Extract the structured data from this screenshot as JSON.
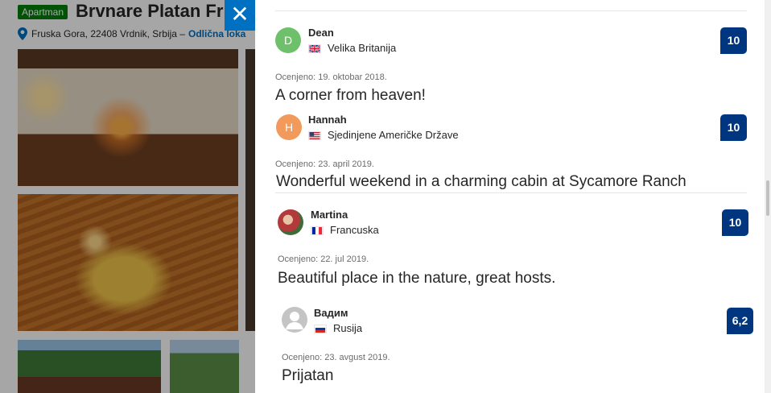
{
  "listing": {
    "type_badge": "Apartman",
    "title": "Brvnare Platan Fr",
    "address": "Fruska Gora, 22408 Vrdnik, Srbija –",
    "location_link": "Odlična loka"
  },
  "modal": {
    "close_label": "✕"
  },
  "reviews": [
    {
      "initial": "D",
      "name": "Dean",
      "country": "Velika Britanija",
      "score": "10",
      "date": "Ocenjeno: 19. oktobar 2018.",
      "title": "A corner from heaven!",
      "avatar_color": "#6fc06a"
    },
    {
      "initial": "H",
      "name": "Hannah",
      "country": "Sjedinjene Američke Države",
      "score": "10",
      "date": "Ocenjeno: 23. april 2019.",
      "title": "Wonderful weekend in a charming cabin at Sycamore Ranch",
      "avatar_color": "#f29a5c"
    },
    {
      "initial": "",
      "name": "Martina",
      "country": "Francuska",
      "score": "10",
      "date": "Ocenjeno: 22. jul 2019.",
      "title": "Beautiful place in the nature, great hosts.",
      "avatar_color": "#b23a3a"
    },
    {
      "initial": "",
      "name": "Вадим",
      "country": "Rusija",
      "score": "6,2",
      "date": "Ocenjeno: 23. avgust 2019.",
      "title": "Prijatan",
      "avatar_color": "#c4c4c4"
    }
  ],
  "colors": {
    "brand_blue": "#0071c2",
    "score_blue": "#003580",
    "badge_green": "#008009"
  }
}
